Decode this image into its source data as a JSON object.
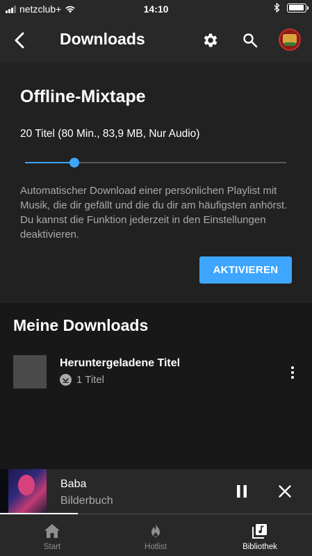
{
  "status_bar": {
    "carrier": "netzclub+",
    "time": "14:10",
    "battery_level": 0.95,
    "signal_bars": 3
  },
  "header": {
    "title": "Downloads",
    "back_icon": "chevron-left-icon",
    "settings_icon": "gear-icon",
    "search_icon": "search-icon"
  },
  "mixtape": {
    "title": "Offline-Mixtape",
    "info": "20 Titel (80 Min., 83,9 MB, Nur Audio)",
    "slider_value": 0.19,
    "description": "Automatischer Download einer persönlichen Playlist mit Musik, die dir gefällt und die du dir am häufigsten anhörst. Du kannst die Funktion jederzeit in den Einstellungen deaktivieren.",
    "activate_label": "AKTIVIEREN",
    "accent_color": "#3ea6ff"
  },
  "my_downloads": {
    "title": "Meine Downloads",
    "items": [
      {
        "name": "Heruntergeladene Titel",
        "meta": "1 Titel",
        "status_icon": "download-check-icon",
        "more_icon": "more-vertical-icon"
      }
    ]
  },
  "mini_player": {
    "title": "Baba",
    "artist": "Bilderbuch",
    "pause_icon": "pause-icon",
    "close_icon": "close-icon",
    "progress": 0.25
  },
  "bottom_nav": {
    "items": [
      {
        "label": "Start",
        "icon": "home-icon",
        "active": false
      },
      {
        "label": "Hotlist",
        "icon": "flame-icon",
        "active": false
      },
      {
        "label": "Bibliothek",
        "icon": "library-icon",
        "active": true
      }
    ]
  }
}
